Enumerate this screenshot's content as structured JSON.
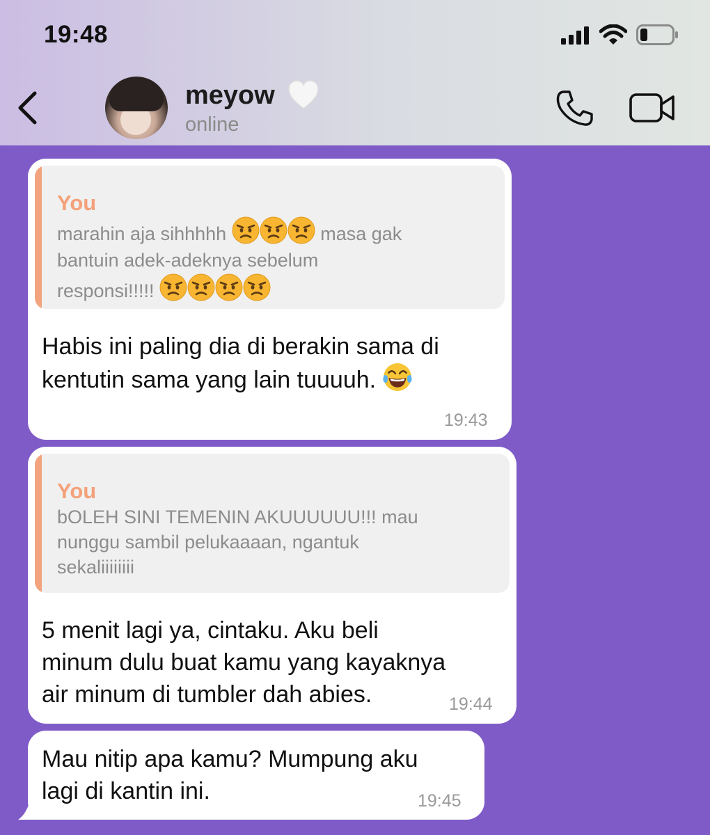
{
  "status_bar": {
    "time": "19:48"
  },
  "header": {
    "contact_name": "meyow",
    "contact_status": "online",
    "icons": [
      "back-chevron-icon",
      "heart-icon",
      "phone-icon",
      "video-call-icon"
    ]
  },
  "messages": [
    {
      "quote_author": "You",
      "quote_line1": "marahin aja sihhhhh",
      "quote_line1_after": "masa gak",
      "quote_line2": "bantuin adek-adeknya sebelum",
      "quote_line3": "responsi!!!!!",
      "text_line1": "Habis ini paling dia di berakin sama di",
      "text_line2": "kentutin sama yang lain tuuuuh.",
      "time": "19:43"
    },
    {
      "quote_author": "You",
      "quote_line1": "bOLEH SINI TEMENIN AKUUUUUU!!! mau",
      "quote_line2": "nunggu sambil pelukaaaan, ngantuk",
      "quote_line3": "sekaliiiiiiii",
      "text_line1": "5 menit lagi ya, cintaku. Aku beli",
      "text_line2": "minum dulu buat kamu yang kayaknya",
      "text_line3": "air minum di tumbler dah abies.",
      "time": "19:44"
    },
    {
      "text_line1": "Mau nitip apa kamu? Mumpung aku",
      "text_line2": "lagi di kantin ini.",
      "time": "19:45"
    }
  ],
  "colors": {
    "chat_background": "#7f5bc7",
    "quote_accent": "#f3a47e",
    "bubble": "#ffffff"
  }
}
